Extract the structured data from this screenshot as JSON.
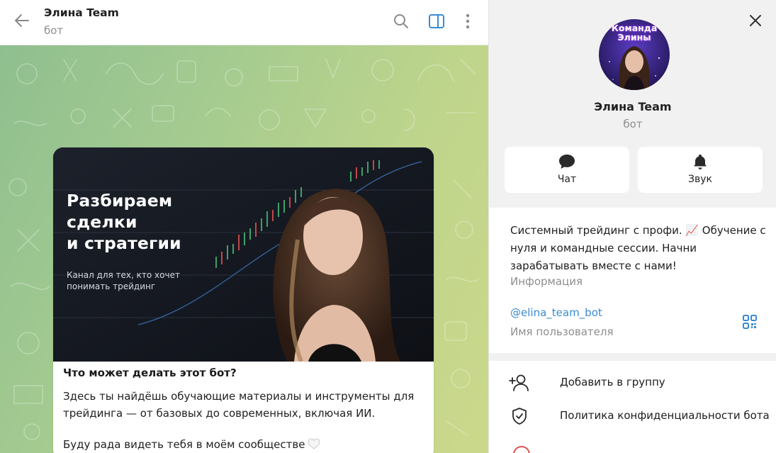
{
  "header": {
    "title": "Элина Team",
    "subtitle": "бот",
    "back_icon": "arrow-left-icon",
    "search_icon": "search-icon",
    "sidebar_toggle_icon": "sidebar-panel-icon",
    "more_icon": "more-vertical-icon",
    "accent_color": "#3a8bd1"
  },
  "message": {
    "media_headline": "Разбираем\nсделки\nи стратегии",
    "media_subtitle": "Канал для тех, кто хочет\nпонимать трейдинг",
    "title": "Что может делать этот бот?",
    "paragraph1": "Здесь ты найдёшь обучающие материалы и инструменты для трейдинга — от базовых до современных, включая ИИ.",
    "paragraph2": "Буду рада видеть тебя в моём сообществе",
    "heart_icon": "white-heart-icon"
  },
  "panel": {
    "close_icon": "close-icon",
    "avatar_text": "Команда\nЭлины",
    "name": "Элина Team",
    "subtitle": "бот",
    "actions": [
      {
        "label": "Чат",
        "icon": "chat-bubble-icon"
      },
      {
        "label": "Звук",
        "icon": "bell-icon"
      }
    ],
    "about": "Системный трейдинг с профи. 📈 Обучение с нуля и командные сессии. Начни зарабатывать вместе с нами!",
    "about_label": "Информация",
    "username": "@elina_team_bot",
    "username_label": "Имя пользователя",
    "qr_icon": "qr-code-icon",
    "menu": [
      {
        "label": "Добавить в группу",
        "icon": "add-user-icon"
      },
      {
        "label": "Политика конфиденциальности бота",
        "icon": "shield-check-icon"
      }
    ]
  }
}
